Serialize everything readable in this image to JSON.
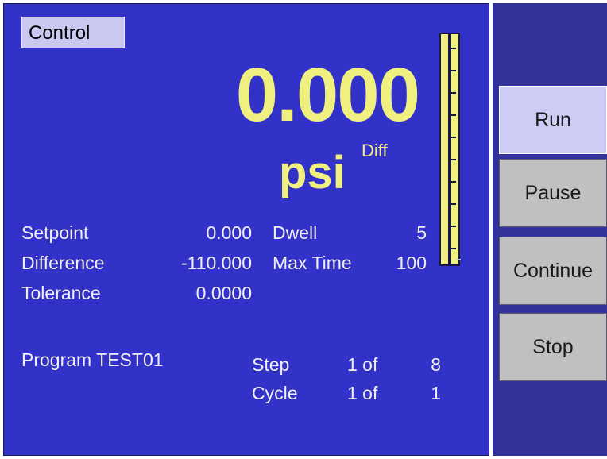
{
  "mode_tab": "Control",
  "reading": {
    "value": "0.000",
    "unit": "psi",
    "unit_qualifier": "Diff"
  },
  "params": {
    "setpoint_label": "Setpoint",
    "setpoint_value": "0.000",
    "difference_label": "Difference",
    "difference_value": "-110.000",
    "tolerance_label": "Tolerance",
    "tolerance_value": "0.0000",
    "dwell_label": "Dwell",
    "dwell_value": "5",
    "maxtime_label": "Max Time",
    "maxtime_value": "100"
  },
  "program": {
    "label": "Program TEST01",
    "step_label": "Step",
    "step_current": "1 of",
    "step_total": "8",
    "cycle_label": "Cycle",
    "cycle_current": "1 of",
    "cycle_total": "1"
  },
  "buttons": {
    "run": "Run",
    "pause": "Pause",
    "continue": "Continue",
    "stop": "Stop"
  },
  "colors": {
    "panel_bg": "#3232c8",
    "side_bg": "#32329a",
    "reading_color": "#f0f080",
    "active_button": "#ccccf4",
    "inactive_button": "#c0c0c0"
  }
}
